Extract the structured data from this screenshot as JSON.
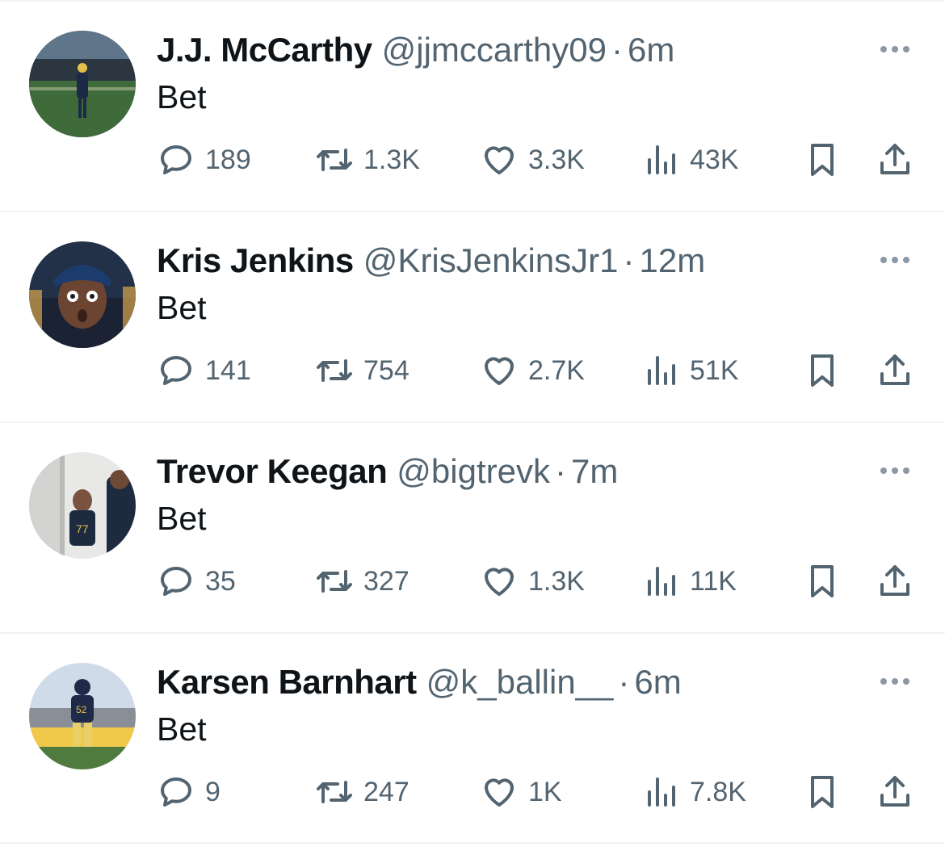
{
  "tweets": [
    {
      "name": "J.J. McCarthy",
      "handle": "@jjmccarthy09",
      "separator": "·",
      "time": "6m",
      "text": "Bet",
      "replies": "189",
      "retweets": "1.3K",
      "likes": "3.3K",
      "views": "43K"
    },
    {
      "name": "Kris Jenkins",
      "handle": "@KrisJenkinsJr1",
      "separator": "·",
      "time": "12m",
      "text": "Bet",
      "replies": "141",
      "retweets": "754",
      "likes": "2.7K",
      "views": "51K"
    },
    {
      "name": "Trevor Keegan",
      "handle": "@bigtrevk",
      "separator": "·",
      "time": "7m",
      "text": "Bet",
      "replies": "35",
      "retweets": "327",
      "likes": "1.3K",
      "views": "11K"
    },
    {
      "name": "Karsen Barnhart",
      "handle": "@k_ballin__",
      "separator": "·",
      "time": "6m",
      "text": "Bet",
      "replies": "9",
      "retweets": "247",
      "likes": "1K",
      "views": "7.8K"
    }
  ],
  "icons": {
    "reply": "reply-icon",
    "retweet": "retweet-icon",
    "like": "heart-icon",
    "views": "views-icon",
    "bookmark": "bookmark-icon",
    "share": "share-icon",
    "more": "more-icon"
  },
  "colors": {
    "text_primary": "#0f1419",
    "text_secondary": "#536471",
    "divider": "#eff3f4"
  }
}
